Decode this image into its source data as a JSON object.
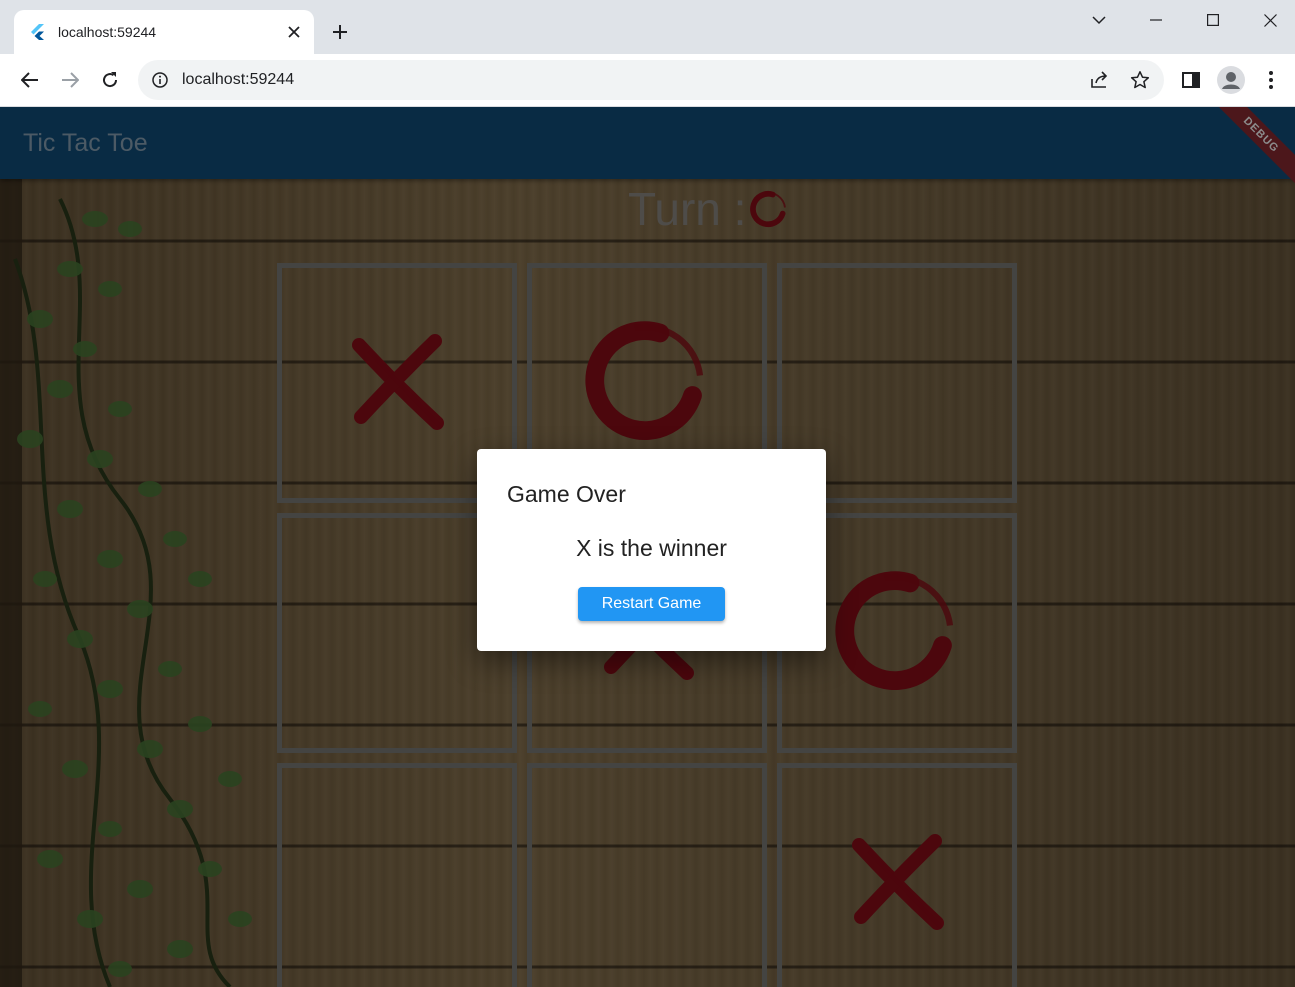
{
  "browser": {
    "tab_title": "localhost:59244",
    "url": "localhost:59244"
  },
  "app": {
    "title": "Tic Tac Toe",
    "debug_banner": "DEBUG",
    "turn_label": "Turn :",
    "turn_symbol": "O",
    "board": [
      "X",
      "O",
      "",
      "",
      "X",
      "O",
      "",
      "",
      "X"
    ],
    "mark_color": "#8b0d18",
    "appbar_color": "#124f7c"
  },
  "dialog": {
    "title": "Game Over",
    "message": "X is the winner",
    "button_label": "Restart Game",
    "button_color": "#2196f3"
  }
}
